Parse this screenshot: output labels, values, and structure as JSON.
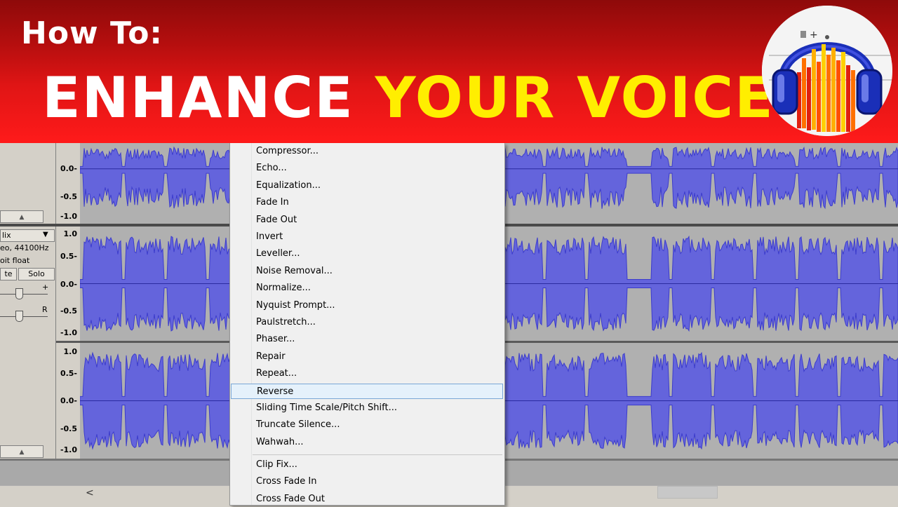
{
  "banner": {
    "how_to": "How To:",
    "headline_white": "ENHANCE",
    "headline_yellow": "YOUR VOICE",
    "bg_color": "#e01515",
    "accent_color": "#ffee00"
  },
  "track_panel": {
    "collapse_glyph": "▲",
    "name": "lix",
    "dropdown_glyph": "▼",
    "format": "eo, 44100Hz",
    "bit_depth": "oit float",
    "mute_label": "te",
    "solo_label": "Solo",
    "gain_plus": "+",
    "pan_right": "R",
    "collapse_glyph_2": "▲"
  },
  "rulers": {
    "track1": [
      "0.0-",
      "-0.5",
      "-1.0"
    ],
    "track2": [
      "1.0",
      "0.5-",
      "0.0-",
      "-0.5",
      "-1.0"
    ],
    "track3": [
      "1.0",
      "0.5-",
      "0.0-",
      "-0.5",
      "-1.0"
    ]
  },
  "effect_menu": {
    "items": [
      "Compressor...",
      "Echo...",
      "Equalization...",
      "Fade In",
      "Fade Out",
      "Invert",
      "Leveller...",
      "Noise Removal...",
      "Normalize...",
      "Nyquist Prompt...",
      "Paulstretch...",
      "Phaser...",
      "Repair",
      "Repeat...",
      "Reverse",
      "Sliding Time Scale/Pitch Shift...",
      "Truncate Silence...",
      "Wahwah..."
    ],
    "selected": "Reverse",
    "items2": [
      "Clip Fix...",
      "Cross Fade In",
      "Cross Fade Out"
    ],
    "highlight_color": "#e5f1fb"
  },
  "scrollbar": {
    "left_arrow": "<"
  },
  "colors": {
    "waveform": "#3c3ccc",
    "waveform_light": "#6464dc",
    "track_bg": "#b0b0b0"
  }
}
